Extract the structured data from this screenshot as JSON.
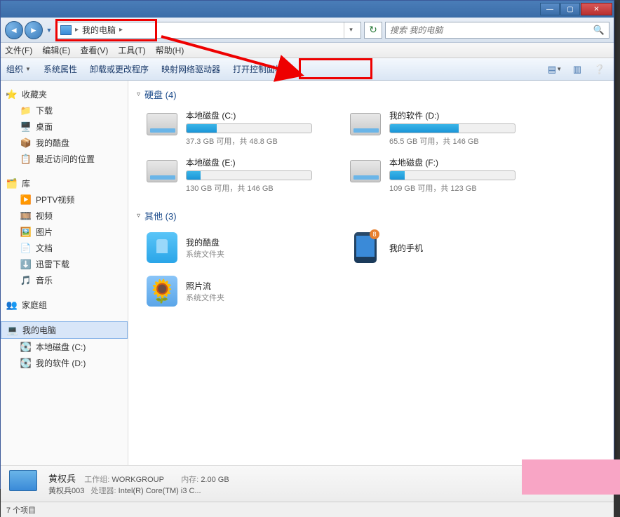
{
  "titlebar": {
    "minimize": "—",
    "maximize": "▢",
    "close": "✕"
  },
  "address": {
    "location": "我的电脑",
    "search_placeholder": "搜索 我的电脑"
  },
  "menu": {
    "file": "文件(F)",
    "edit": "编辑(E)",
    "view": "查看(V)",
    "tools": "工具(T)",
    "help": "帮助(H)"
  },
  "toolbar": {
    "organize": "组织",
    "properties": "系统属性",
    "uninstall": "卸载或更改程序",
    "mapdrive": "映射网络驱动器",
    "controlpanel": "打开控制面板"
  },
  "sidebar": {
    "favorites": {
      "label": "收藏夹",
      "items": [
        "下载",
        "桌面",
        "我的酷盘",
        "最近访问的位置"
      ]
    },
    "libraries": {
      "label": "库",
      "items": [
        "PPTV视频",
        "视频",
        "图片",
        "文档",
        "迅雷下载",
        "音乐"
      ]
    },
    "homegroup": {
      "label": "家庭组"
    },
    "computer": {
      "label": "我的电脑",
      "items": [
        "本地磁盘 (C:)",
        "我的软件 (D:)"
      ]
    }
  },
  "main": {
    "drives_header": "硬盘 (4)",
    "others_header": "其他 (3)",
    "drives": [
      {
        "name": "本地磁盘 (C:)",
        "stats": "37.3 GB 可用，共 48.8 GB",
        "fill": 24
      },
      {
        "name": "我的软件 (D:)",
        "stats": "65.5 GB 可用，共 146 GB",
        "fill": 55
      },
      {
        "name": "本地磁盘 (E:)",
        "stats": "130 GB 可用，共 146 GB",
        "fill": 11
      },
      {
        "name": "本地磁盘 (F:)",
        "stats": "109 GB 可用，共 123 GB",
        "fill": 12
      }
    ],
    "others": [
      {
        "name": "我的酷盘",
        "sub": "系统文件夹"
      },
      {
        "name": "我的手机",
        "sub": ""
      },
      {
        "name": "照片流",
        "sub": "系统文件夹"
      }
    ]
  },
  "detail": {
    "title": "黄权兵",
    "user": "黄权兵003",
    "workgroup_lbl": "工作组:",
    "workgroup": "WORKGROUP",
    "cpu_lbl": "处理器:",
    "cpu": "Intel(R) Core(TM) i3 C...",
    "mem_lbl": "内存:",
    "mem": "2.00 GB"
  },
  "status": {
    "items": "7 个项目"
  }
}
